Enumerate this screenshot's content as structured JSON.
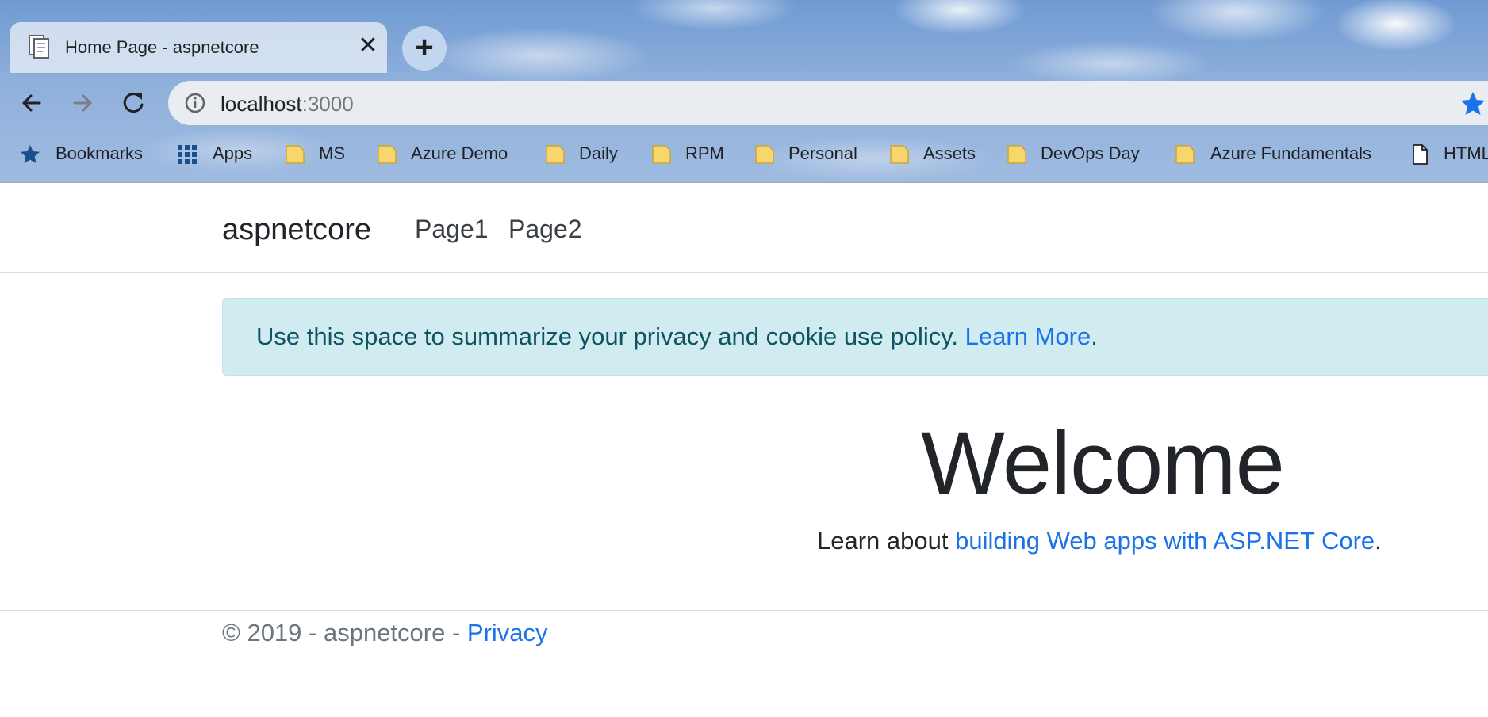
{
  "browser": {
    "tab": {
      "title": "Home Page - aspnetcore",
      "close_label": "✕"
    },
    "new_tab_label": "+",
    "url": {
      "host": "localhost",
      "port": ":3000"
    },
    "bookmarks": [
      {
        "label": "Bookmarks",
        "icon": "star-icon"
      },
      {
        "label": "Apps",
        "icon": "apps-grid-icon"
      },
      {
        "label": "MS",
        "icon": "folder-icon"
      },
      {
        "label": "Azure Demo",
        "icon": "folder-icon"
      },
      {
        "label": "Daily",
        "icon": "folder-icon"
      },
      {
        "label": "RPM",
        "icon": "folder-icon"
      },
      {
        "label": "Personal",
        "icon": "folder-icon"
      },
      {
        "label": "Assets",
        "icon": "folder-icon"
      },
      {
        "label": "DevOps Day",
        "icon": "folder-icon"
      },
      {
        "label": "Azure Fundamentals",
        "icon": "folder-icon"
      },
      {
        "label": "HTML",
        "icon": "page-icon"
      }
    ],
    "colors": {
      "star": "#1a73e8",
      "folder": "#f7d76b",
      "bookmark_star": "#1a4e8c"
    }
  },
  "site": {
    "brand": "aspnetcore",
    "nav": [
      "Page1",
      "Page2"
    ],
    "cookie_banner": {
      "text": "Use this space to summarize your privacy and cookie use policy.",
      "link": "Learn More",
      "trailing": "."
    },
    "welcome": "Welcome",
    "learn": {
      "prefix": "Learn about",
      "link": "building Web apps with ASP.NET Core",
      "trailing": "."
    },
    "footer": {
      "text": "© 2019 - aspnetcore -",
      "link": "Privacy"
    }
  }
}
